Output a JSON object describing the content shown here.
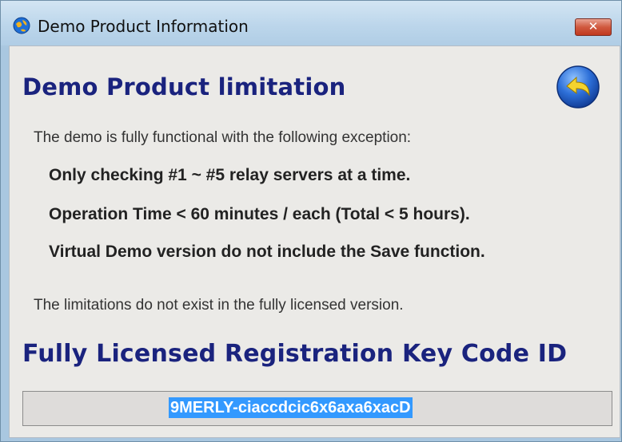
{
  "window": {
    "title": "Demo Product Information",
    "close_glyph": "✕"
  },
  "icons": {
    "app": "globe-icon",
    "back": "back-arrow-icon"
  },
  "colors": {
    "heading": "#1a237e",
    "selection": "#3399ff",
    "close_button": "#d0593f",
    "back_button": "#2d6fd8",
    "back_arrow": "#f3d32e"
  },
  "limitation": {
    "heading": "Demo Product limitation",
    "intro": "The demo is fully functional with the following exception:",
    "items": [
      "Only checking #1 ~ #5 relay servers at a time.",
      "Operation Time < 60 minutes / each (Total < 5 hours).",
      "Virtual Demo version do not include the Save function."
    ],
    "note": "The limitations do not exist in the fully licensed version."
  },
  "registration": {
    "heading": "Fully Licensed Registration Key Code ID",
    "key_value": "9MERLY-ciaccdcic6x6axa6xacD"
  }
}
